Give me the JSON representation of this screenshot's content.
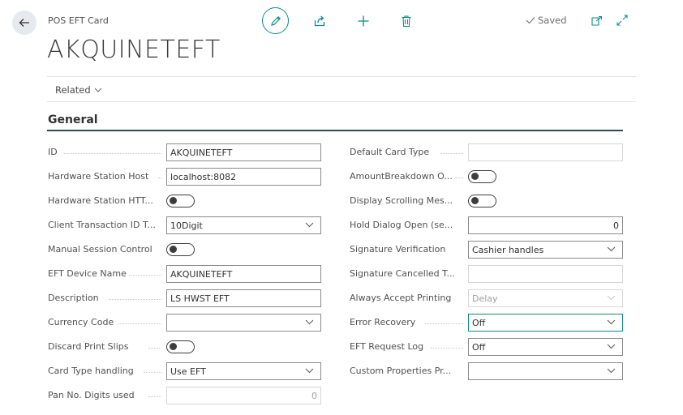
{
  "header": {
    "caption": "POS EFT Card",
    "title": "AKQUINETEFT",
    "saved_label": "Saved",
    "related_label": "Related"
  },
  "group": {
    "title": "General"
  },
  "left_fields": [
    {
      "label": "ID",
      "value": "AKQUINETEFT",
      "kind": "text"
    },
    {
      "label": "Hardware Station Host",
      "value": "localhost:8082",
      "kind": "text"
    },
    {
      "label": "Hardware Station HTT...",
      "value": "",
      "kind": "toggle"
    },
    {
      "label": "Client Transaction ID T...",
      "value": "10Digit",
      "kind": "select"
    },
    {
      "label": "Manual Session Control",
      "value": "",
      "kind": "toggle"
    },
    {
      "label": "EFT Device Name",
      "value": "AKQUINETEFT",
      "kind": "text"
    },
    {
      "label": "Description",
      "value": "LS HWST EFT",
      "kind": "text"
    },
    {
      "label": "Currency Code",
      "value": "",
      "kind": "select"
    },
    {
      "label": "Discard Print Slips",
      "value": "",
      "kind": "toggle"
    },
    {
      "label": "Card Type handling",
      "value": "Use EFT",
      "kind": "select"
    },
    {
      "label": "Pan No. Digits used",
      "value": "0",
      "kind": "number-ro"
    }
  ],
  "right_fields": [
    {
      "label": "Default Card Type",
      "value": "",
      "kind": "text-ro"
    },
    {
      "label": "AmountBreakdown O...",
      "value": "",
      "kind": "toggle"
    },
    {
      "label": "Display Scrolling Mes...",
      "value": "",
      "kind": "toggle"
    },
    {
      "label": "Hold Dialog Open (se...",
      "value": "0",
      "kind": "number"
    },
    {
      "label": "Signature Verification",
      "value": "Cashier handles",
      "kind": "select"
    },
    {
      "label": "Signature Cancelled T...",
      "value": "",
      "kind": "text-ro"
    },
    {
      "label": "Always Accept Printing",
      "value": "Delay",
      "kind": "select-ro"
    },
    {
      "label": "Error Recovery",
      "value": "Off",
      "kind": "select-focus"
    },
    {
      "label": "EFT Request Log",
      "value": "Off",
      "kind": "select"
    },
    {
      "label": "Custom Properties Pr...",
      "value": "",
      "kind": "select"
    }
  ],
  "toolbar_icons": [
    "back-arrow-icon",
    "edit-pencil-icon",
    "share-icon",
    "add-plus-icon",
    "delete-trash-icon",
    "checkmark-icon",
    "open-new-window-icon",
    "expand-icon"
  ]
}
